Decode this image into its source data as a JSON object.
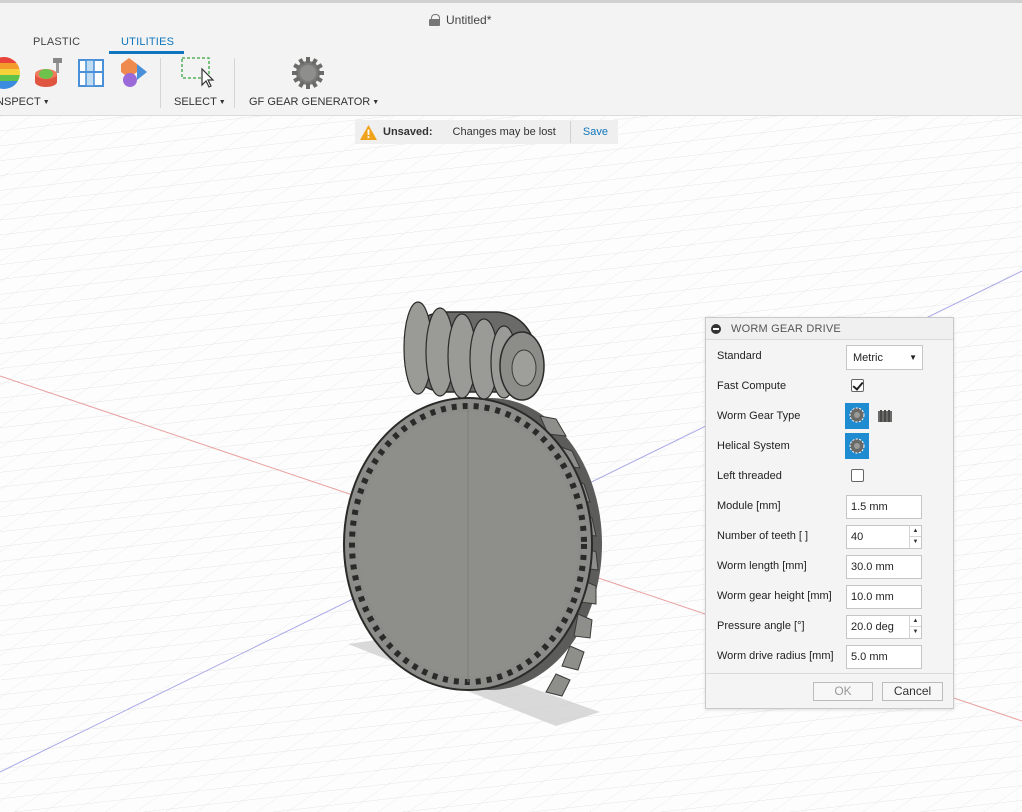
{
  "window": {
    "title": "Untitled*"
  },
  "toolbar": {
    "tabs": [
      {
        "label": "PLASTIC",
        "active": false
      },
      {
        "label": "UTILITIES",
        "active": true
      }
    ],
    "groups": [
      {
        "label": "INSPECT"
      },
      {
        "label": "SELECT"
      },
      {
        "label": "GF GEAR GENERATOR"
      }
    ]
  },
  "banner": {
    "title": "Unsaved:",
    "message": "Changes may be lost",
    "action": "Save"
  },
  "dialog": {
    "title": "WORM GEAR DRIVE",
    "fields": {
      "standard": {
        "label": "Standard",
        "value": "Metric"
      },
      "fast_compute": {
        "label": "Fast Compute",
        "checked": true
      },
      "worm_gear_type": {
        "label": "Worm Gear Type"
      },
      "helical_system": {
        "label": "Helical System"
      },
      "left_threaded": {
        "label": "Left threaded",
        "checked": false
      },
      "module": {
        "label": "Module [mm]",
        "value": "1.5 mm"
      },
      "num_teeth": {
        "label": "Number of teeth [ ]",
        "value": "40"
      },
      "worm_length": {
        "label": "Worm length [mm]",
        "value": "30.0 mm"
      },
      "worm_gear_height": {
        "label": "Worm gear height [mm]",
        "value": "10.0 mm"
      },
      "pressure_angle": {
        "label": "Pressure angle [°]",
        "value": "20.0 deg"
      },
      "worm_drive_radius": {
        "label": "Worm drive radius [mm]",
        "value": "5.0 mm"
      }
    },
    "ok_label": "OK",
    "cancel_label": "Cancel"
  },
  "colors": {
    "accent": "#0e76bc",
    "selected_button": "#1f8bd1",
    "warning": "#f0a31a",
    "x_axis": "#e05a5a",
    "z_axis": "#5a5ae0",
    "gear_gray": "#8a8a86"
  },
  "icons": {
    "inspect": "rainbow-analysis-icon",
    "measure": "measure-icon",
    "section": "section-analysis-icon",
    "shapes": "display-shapes-icon",
    "select": "window-select-icon",
    "gear": "gear-generator-icon"
  }
}
